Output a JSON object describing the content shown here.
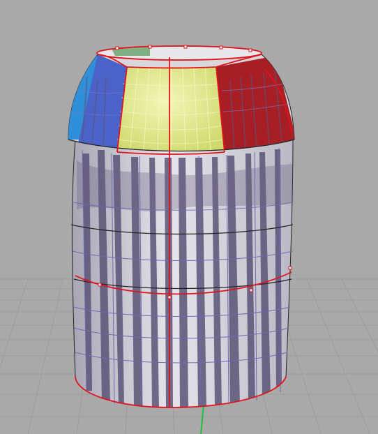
{
  "viewport": {
    "background": "#a9a9a9",
    "grid_color": "#9a9a9a",
    "axis_color": "#1fbf3a"
  },
  "model": {
    "body_color": "#d9d7dc",
    "stripe_color": "#5b5477",
    "seam_color": "#e0141d",
    "iso_color": "#6b6bb0",
    "zones": {
      "blue": "#4b63c9",
      "cyan": "#2f8fd8",
      "yellow": "#e5ec86",
      "red": "#a81e25"
    }
  }
}
